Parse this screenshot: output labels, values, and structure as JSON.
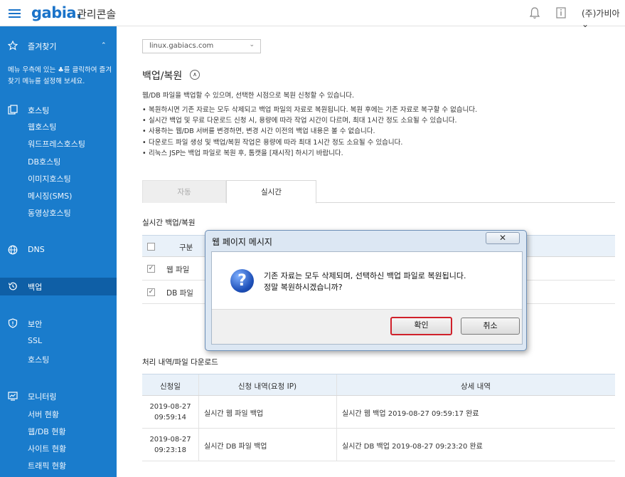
{
  "header": {
    "logo": "gabia.",
    "console_title": "관리콘솔",
    "user": "(주)가비아⌄"
  },
  "sidebar": {
    "favorites": {
      "label": "즐겨찾기",
      "note": "메뉴 우측에 있는 ♣를 클릭하여 즐겨찾기 메뉴를 설정해 보세요."
    },
    "hosting": {
      "label": "호스팅",
      "items": [
        "웹호스팅",
        "워드프레스호스팅",
        "DB호스팅",
        "이미지호스팅",
        "메시징(SMS)",
        "동영상호스팅"
      ]
    },
    "dns": {
      "label": "DNS"
    },
    "backup": {
      "label": "백업"
    },
    "security": {
      "label": "보안",
      "items": [
        "SSL",
        "호스팅"
      ]
    },
    "monitoring": {
      "label": "모니터링",
      "items": [
        "서버 현황",
        "웹/DB 현황",
        "사이트 현황",
        "트래픽 현황"
      ]
    }
  },
  "main": {
    "server_select": "linux.gabiacs.com",
    "title": "백업/복원",
    "description": "웹/DB 파일을 백업할 수 있으며, 선택한 시점으로 복원 신청할 수 있습니다.",
    "bullets": [
      "복원하시면 기존 자료는 모두 삭제되고 백업 파일의 자료로 복원됩니다. 복원 후에는 기존 자료로 복구할 수 없습니다.",
      "실시간 백업 및 무료 다운로드 신청 시, 용량에 따라 작업 시간이 다르며, 최대 1시간 정도 소요될 수 있습니다.",
      "사용하는 웹/DB 서버를 변경하면, 변경 시간 이전의 백업 내용은 볼 수 없습니다.",
      "다운로드 파일 생성 및 백업/복원 작업은 용량에 따라 최대 1시간 정도 소요될 수 있습니다.",
      "리눅스 JSP는 백업 파일로 복원 후, 톰캣을 [재시작] 하시기 바랍니다."
    ],
    "tabs": [
      "자동",
      "실시간"
    ],
    "realtime_section": "실시간 백업/복원",
    "realtime_table": {
      "header": "구분",
      "rows": [
        "웹 파일",
        "DB 파일"
      ]
    },
    "history_section": "처리 내역/파일 다운로드",
    "history_table": {
      "headers": [
        "신청일",
        "신청 내역(요청 IP)",
        "상세 내역"
      ],
      "rows": [
        {
          "date": "2019-08-27",
          "time": "09:59:14",
          "request": "실시간 웹 파일 백업",
          "detail": "실시간 웹 백업 2019-08-27 09:59:17 완료"
        },
        {
          "date": "2019-08-27",
          "time": "09:23:18",
          "request": "실시간 DB 파일 백업",
          "detail": "실시간 DB 백업 2019-08-27 09:23:20 완료"
        }
      ]
    }
  },
  "dialog": {
    "title": "웹 페이지 메시지",
    "close": "✕",
    "message_line1": "기존 자료는 모두 삭제되며, 선택하신 백업 파일로 복원됩니다.",
    "message_line2": "정말 복원하시겠습니까?",
    "ok": "확인",
    "cancel": "취소"
  }
}
